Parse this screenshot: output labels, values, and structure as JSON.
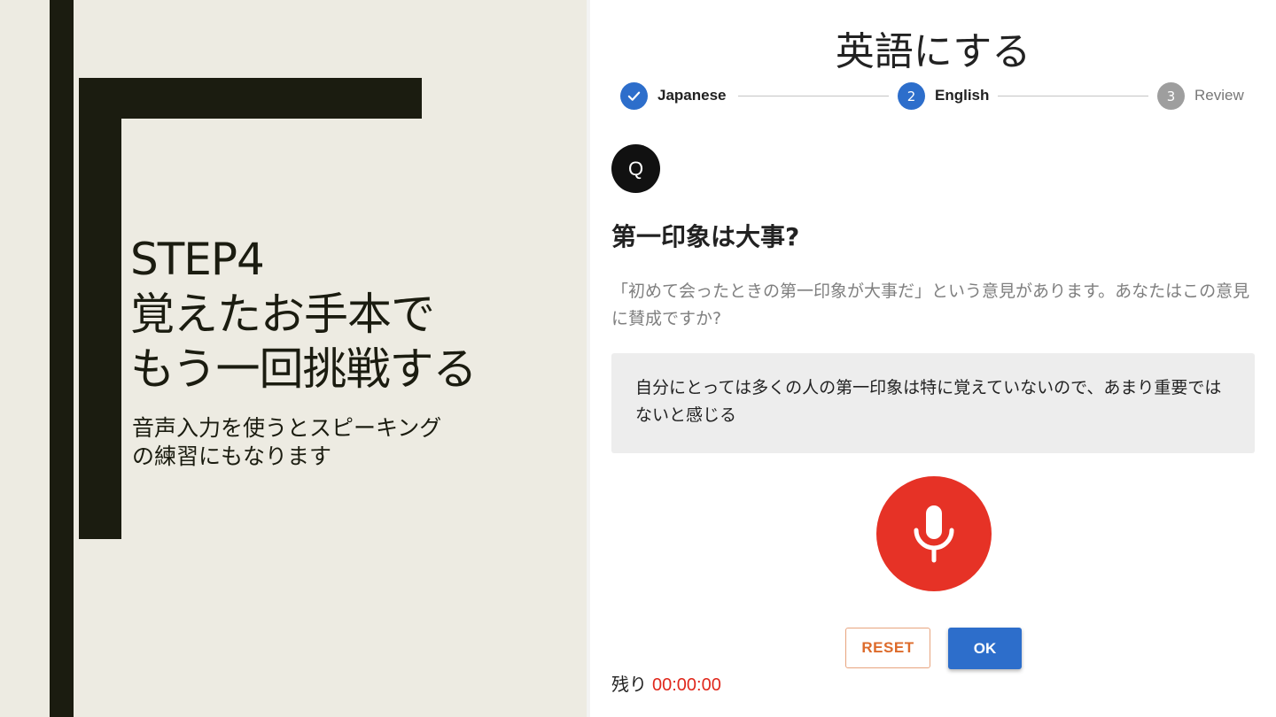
{
  "slide": {
    "title_lines": [
      "STEP4",
      "覚えたお手本で",
      "もう一回挑戦する"
    ],
    "subtitle": "音声入力を使うとスピーキングの練習にもなります"
  },
  "app": {
    "title": "英語にする",
    "steps": [
      {
        "label": "Japanese",
        "status": "completed",
        "marker": "check-icon"
      },
      {
        "label": "English",
        "status": "active",
        "number": "2"
      },
      {
        "label": "Review",
        "status": "inactive",
        "number": "3"
      }
    ],
    "avatar_letter": "Q",
    "question": "第一印象は大事?",
    "prompt": "「初めて会ったときの第一印象が大事だ」という意見があります。あなたはこの意見に賛成ですか?",
    "answer": "自分にとっては多くの人の第一印象は特に覚えていないので、あまり重要ではないと感じる",
    "mic_icon": "microphone-icon",
    "buttons": {
      "reset": "RESET",
      "ok": "OK"
    },
    "timer": {
      "label": "残り",
      "value": "00:00:00"
    }
  },
  "colors": {
    "slide_bg": "#edebe2",
    "slide_dark": "#1b1c10",
    "step_active": "#2d6ecb",
    "step_inactive": "#9e9e9e",
    "mic": "#e63226",
    "reset": "#dd6b2b",
    "ok": "#2d6ecb",
    "timer": "#e0281c"
  }
}
